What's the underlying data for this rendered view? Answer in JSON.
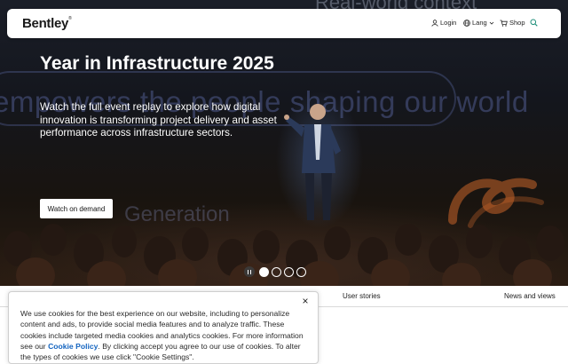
{
  "nav": {
    "logo": "Bentley",
    "logo_tm": "®",
    "login_label": "Login",
    "lang_label": "Lang",
    "shop_label": "Shop"
  },
  "hero": {
    "title": "Year in Infrastructure 2025",
    "description": "Watch the full event replay to explore how digital innovation is transforming project delivery and asset performance across infrastructure sectors.",
    "cta_label": "Watch on demand",
    "background_text_main": "empowers the people shaping our world",
    "background_text_top": "Real-world context",
    "background_text_mid": "Generation",
    "carousel": {
      "slide_count": 4,
      "active_slide": 1
    }
  },
  "subnav": {
    "tabs": [
      "User stories",
      "News and views"
    ]
  },
  "cookie_banner": {
    "text_before": "We use cookies for the best experience on our website, including to personalize content and ads, to provide social media features and to analyze traffic. These cookies include targeted media cookies and analytics cookies. For more information see our ",
    "policy_link": "Cookie Policy",
    "text_after": ". By clicking accept you agree to our use of cookies. To alter the types of cookies we use click \"Cookie Settings\".",
    "close_glyph": "×"
  },
  "colors": {
    "link": "#1565c0",
    "nav_bg": "#ffffff",
    "hero_overlay": "#14161d",
    "accent_orange": "#c8642a"
  }
}
